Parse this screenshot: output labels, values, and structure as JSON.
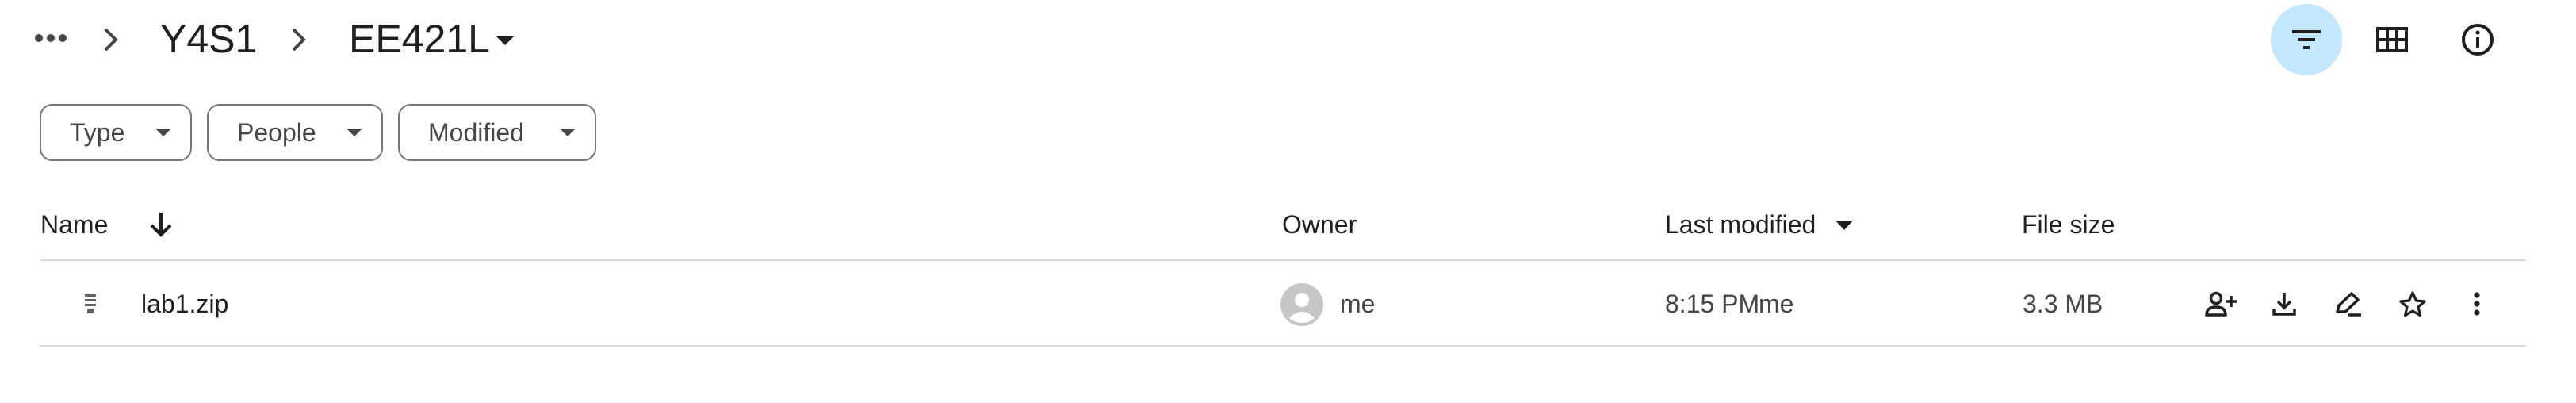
{
  "breadcrumb": {
    "overflow_icon": "more-horiz-icon",
    "items": [
      "Y4S1",
      "EE421L"
    ],
    "separator_icon": "chevron-right-icon",
    "dropdown_icon": "arrow-drop-down-icon"
  },
  "toolbar": {
    "buttons": [
      {
        "name": "filter",
        "icon": "filter-list-icon",
        "active": true
      },
      {
        "name": "grid-layout",
        "icon": "grid-view-icon",
        "active": false
      },
      {
        "name": "details",
        "icon": "info-icon",
        "active": false
      }
    ]
  },
  "filters": [
    {
      "label": "Type"
    },
    {
      "label": "People"
    },
    {
      "label": "Modified"
    }
  ],
  "table": {
    "columns": {
      "name": "Name",
      "owner": "Owner",
      "last_modified": "Last modified",
      "file_size": "File size"
    },
    "sort": {
      "name_direction_icon": "arrow-downward-icon",
      "last_modified_icon": "arrow-drop-down-icon"
    },
    "rows": [
      {
        "name": "lab1.zip",
        "type_icon": "zip-file-icon",
        "owner": "me",
        "modified_time": "8:15 PM",
        "modified_by": "me",
        "size": "3.3 MB",
        "actions": [
          "share-icon",
          "download-icon",
          "rename-icon",
          "star-icon",
          "more-vert-icon"
        ]
      }
    ]
  },
  "colors": {
    "active_toggle_bg": "#c2e7ff",
    "chip_border": "#747775",
    "divider": "#d8d8d8"
  }
}
